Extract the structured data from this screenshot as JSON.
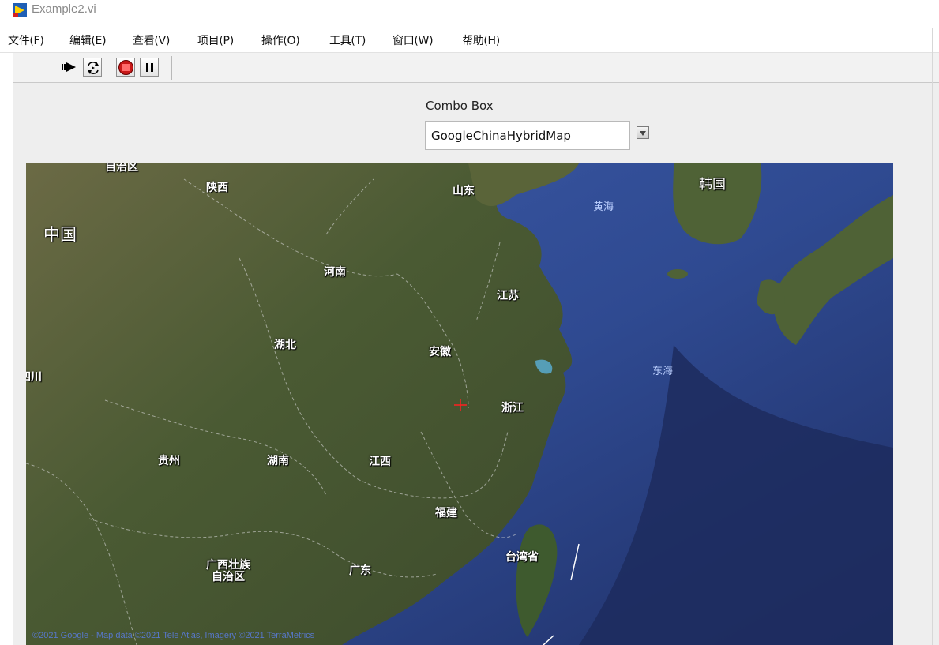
{
  "window": {
    "title": "Example2.vi"
  },
  "menu": {
    "items": [
      "文件(F)",
      "编辑(E)",
      "查看(V)",
      "项目(P)",
      "操作(O)",
      "工具(T)",
      "窗口(W)",
      "帮助(H)"
    ]
  },
  "toolbar": {
    "icons": [
      "run-arrow-icon",
      "run-continuously-icon",
      "abort-icon",
      "pause-icon"
    ]
  },
  "combo": {
    "label": "Combo Box",
    "value": "GoogleChinaHybridMap"
  },
  "map": {
    "labels": {
      "zizhiqu_top": "自治区",
      "shaanxi": "陕西",
      "shandong": "山东",
      "huanghai": "黄海",
      "hanguo": "韩国",
      "zhongguo": "中国",
      "henan": "河南",
      "jiangsu": "江苏",
      "hubei": "湖北",
      "anhui": "安徽",
      "sichuan_partial": "四川",
      "donghai": "东海",
      "zhejiang": "浙江",
      "guizhou": "贵州",
      "hunan": "湖南",
      "jiangxi": "江西",
      "fujian": "福建",
      "taiwan": "台湾省",
      "guangxi_line1": "广西壮族",
      "guangxi_line2": "自治区",
      "guangdong": "广东"
    },
    "attribution": "©2021 Google - Map data ©2021 Tele Atlas, Imagery ©2021 TerraMetrics",
    "colors": {
      "land": "#4d5a35",
      "sea": "#2f4a91",
      "deep_sea": "#1f2f66",
      "marker": "#ff2020"
    }
  }
}
